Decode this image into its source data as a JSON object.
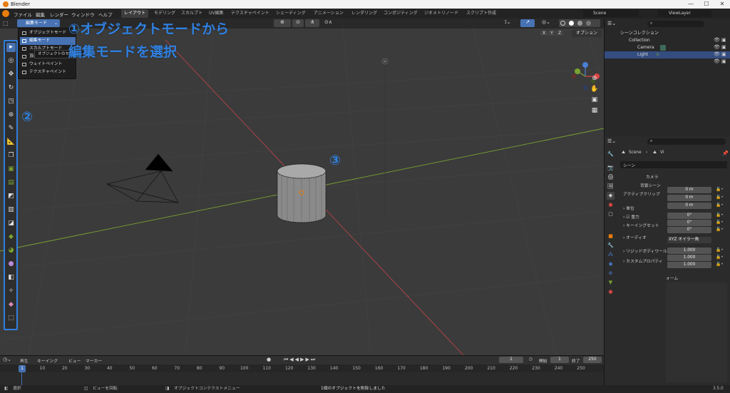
{
  "window": {
    "title": "Blender",
    "min": "—",
    "max": "☐",
    "close": "✕"
  },
  "menu": {
    "items": [
      "ファイル",
      "編集",
      "レンダー",
      "ウィンドウ",
      "ヘルプ"
    ],
    "workspaces": [
      "レイアウト",
      "モデリング",
      "スカルプト",
      "UV編集",
      "テクスチャペイント",
      "シェーディング",
      "アニメーション",
      "レンダリング",
      "コンポジティング",
      "ジオメトリノード",
      "スクリプト作成"
    ],
    "scene_label": "Scene",
    "viewlayer_label": "ViewLayer"
  },
  "viewport": {
    "mode_selected": "編集モード",
    "options_label": "オプション",
    "axis_labels": {
      "x": "X",
      "y": "Y",
      "z": "Z"
    },
    "dropdown_items": [
      "オブジェクトモード",
      "編集モード",
      "スカルプトモード",
      "頂点ペイント",
      "ウェイトペイント",
      "テクスチャペイント"
    ],
    "tooltip": "オブジェクトのモード"
  },
  "annotations": {
    "step1_line1": "①オブジェクトモードから",
    "step1_line2": "編集モードを選択",
    "step2": "②",
    "step3": "③"
  },
  "outliner": {
    "title": "シーンコレクション",
    "collection": "Collection",
    "camera": "Camera",
    "light": "Light"
  },
  "properties": {
    "breadcrumb_scene": "Scene",
    "breadcrumb_view": "Vi",
    "section_scene": "シーン",
    "camera": "カメラ",
    "background_scene": "背景シーン",
    "active_clip": "アクティブクリップ",
    "units": "単位",
    "gravity": "重力",
    "keying_sets": "キーイングセット",
    "audio": "オーディオ",
    "rigid_world": "リジッドボディワール",
    "custom_props": "カスタムプロパティ",
    "values": [
      "0 m",
      "0 m",
      "0 m",
      "0°",
      "0°",
      "0°",
      "XYZ オイラー角",
      "1.000",
      "1.000",
      "1.000"
    ],
    "form": "ォーム"
  },
  "timeline": {
    "play": "再生",
    "keying": "キーイング",
    "view": "ビュー",
    "marker": "マーカー",
    "current": "1",
    "start_label": "開始",
    "start": "1",
    "end_label": "終了",
    "end": "250",
    "ticks": [
      "1",
      "10",
      "20",
      "30",
      "40",
      "50",
      "60",
      "70",
      "80",
      "90",
      "100",
      "110",
      "120",
      "130",
      "140",
      "150",
      "160",
      "170",
      "180",
      "190",
      "200",
      "210",
      "220",
      "230",
      "240",
      "250"
    ]
  },
  "status": {
    "select": "選択",
    "rotate": "ビューを回転",
    "context": "オブジェクトコンテクストメニュー",
    "info": "1個のオブジェクトを削除しました",
    "version": "3.5.0"
  }
}
